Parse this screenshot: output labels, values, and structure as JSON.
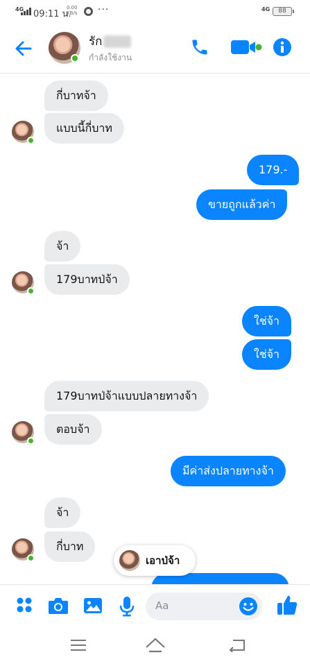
{
  "status_bar": {
    "network": "4G",
    "time": "09:11 น.",
    "speed_value": "0.00",
    "speed_unit": "KB/s",
    "more": "···",
    "right_network": "4G",
    "battery": "88"
  },
  "header": {
    "contact_name": "รัก",
    "contact_status": "กำลังใช้งาน"
  },
  "messages": {
    "m1": "กี่บาทจ้า",
    "m2": "แบบนี้กี่บาท",
    "m3": "179.-",
    "m4": "ขายถูกแล้วค่า",
    "m5": "จ้า",
    "m6": "179บาทป่จ้า",
    "m7": "ใช่จ้า",
    "m8": "ใช่จ้า",
    "m9": "179บาทป่จ้าแบบปลายทางจ้า",
    "m10": "ตอบจ้า",
    "m11": "มีค่าส่งปลายทางจ้า",
    "m12": "จ้า",
    "m13": "กี่บาท"
  },
  "typing": {
    "text": "เอาป่จ้า"
  },
  "composer": {
    "placeholder": "Aa"
  },
  "colors": {
    "accent": "#0a84ff",
    "incoming_bubble": "#eaebed",
    "online": "#42b72a"
  }
}
